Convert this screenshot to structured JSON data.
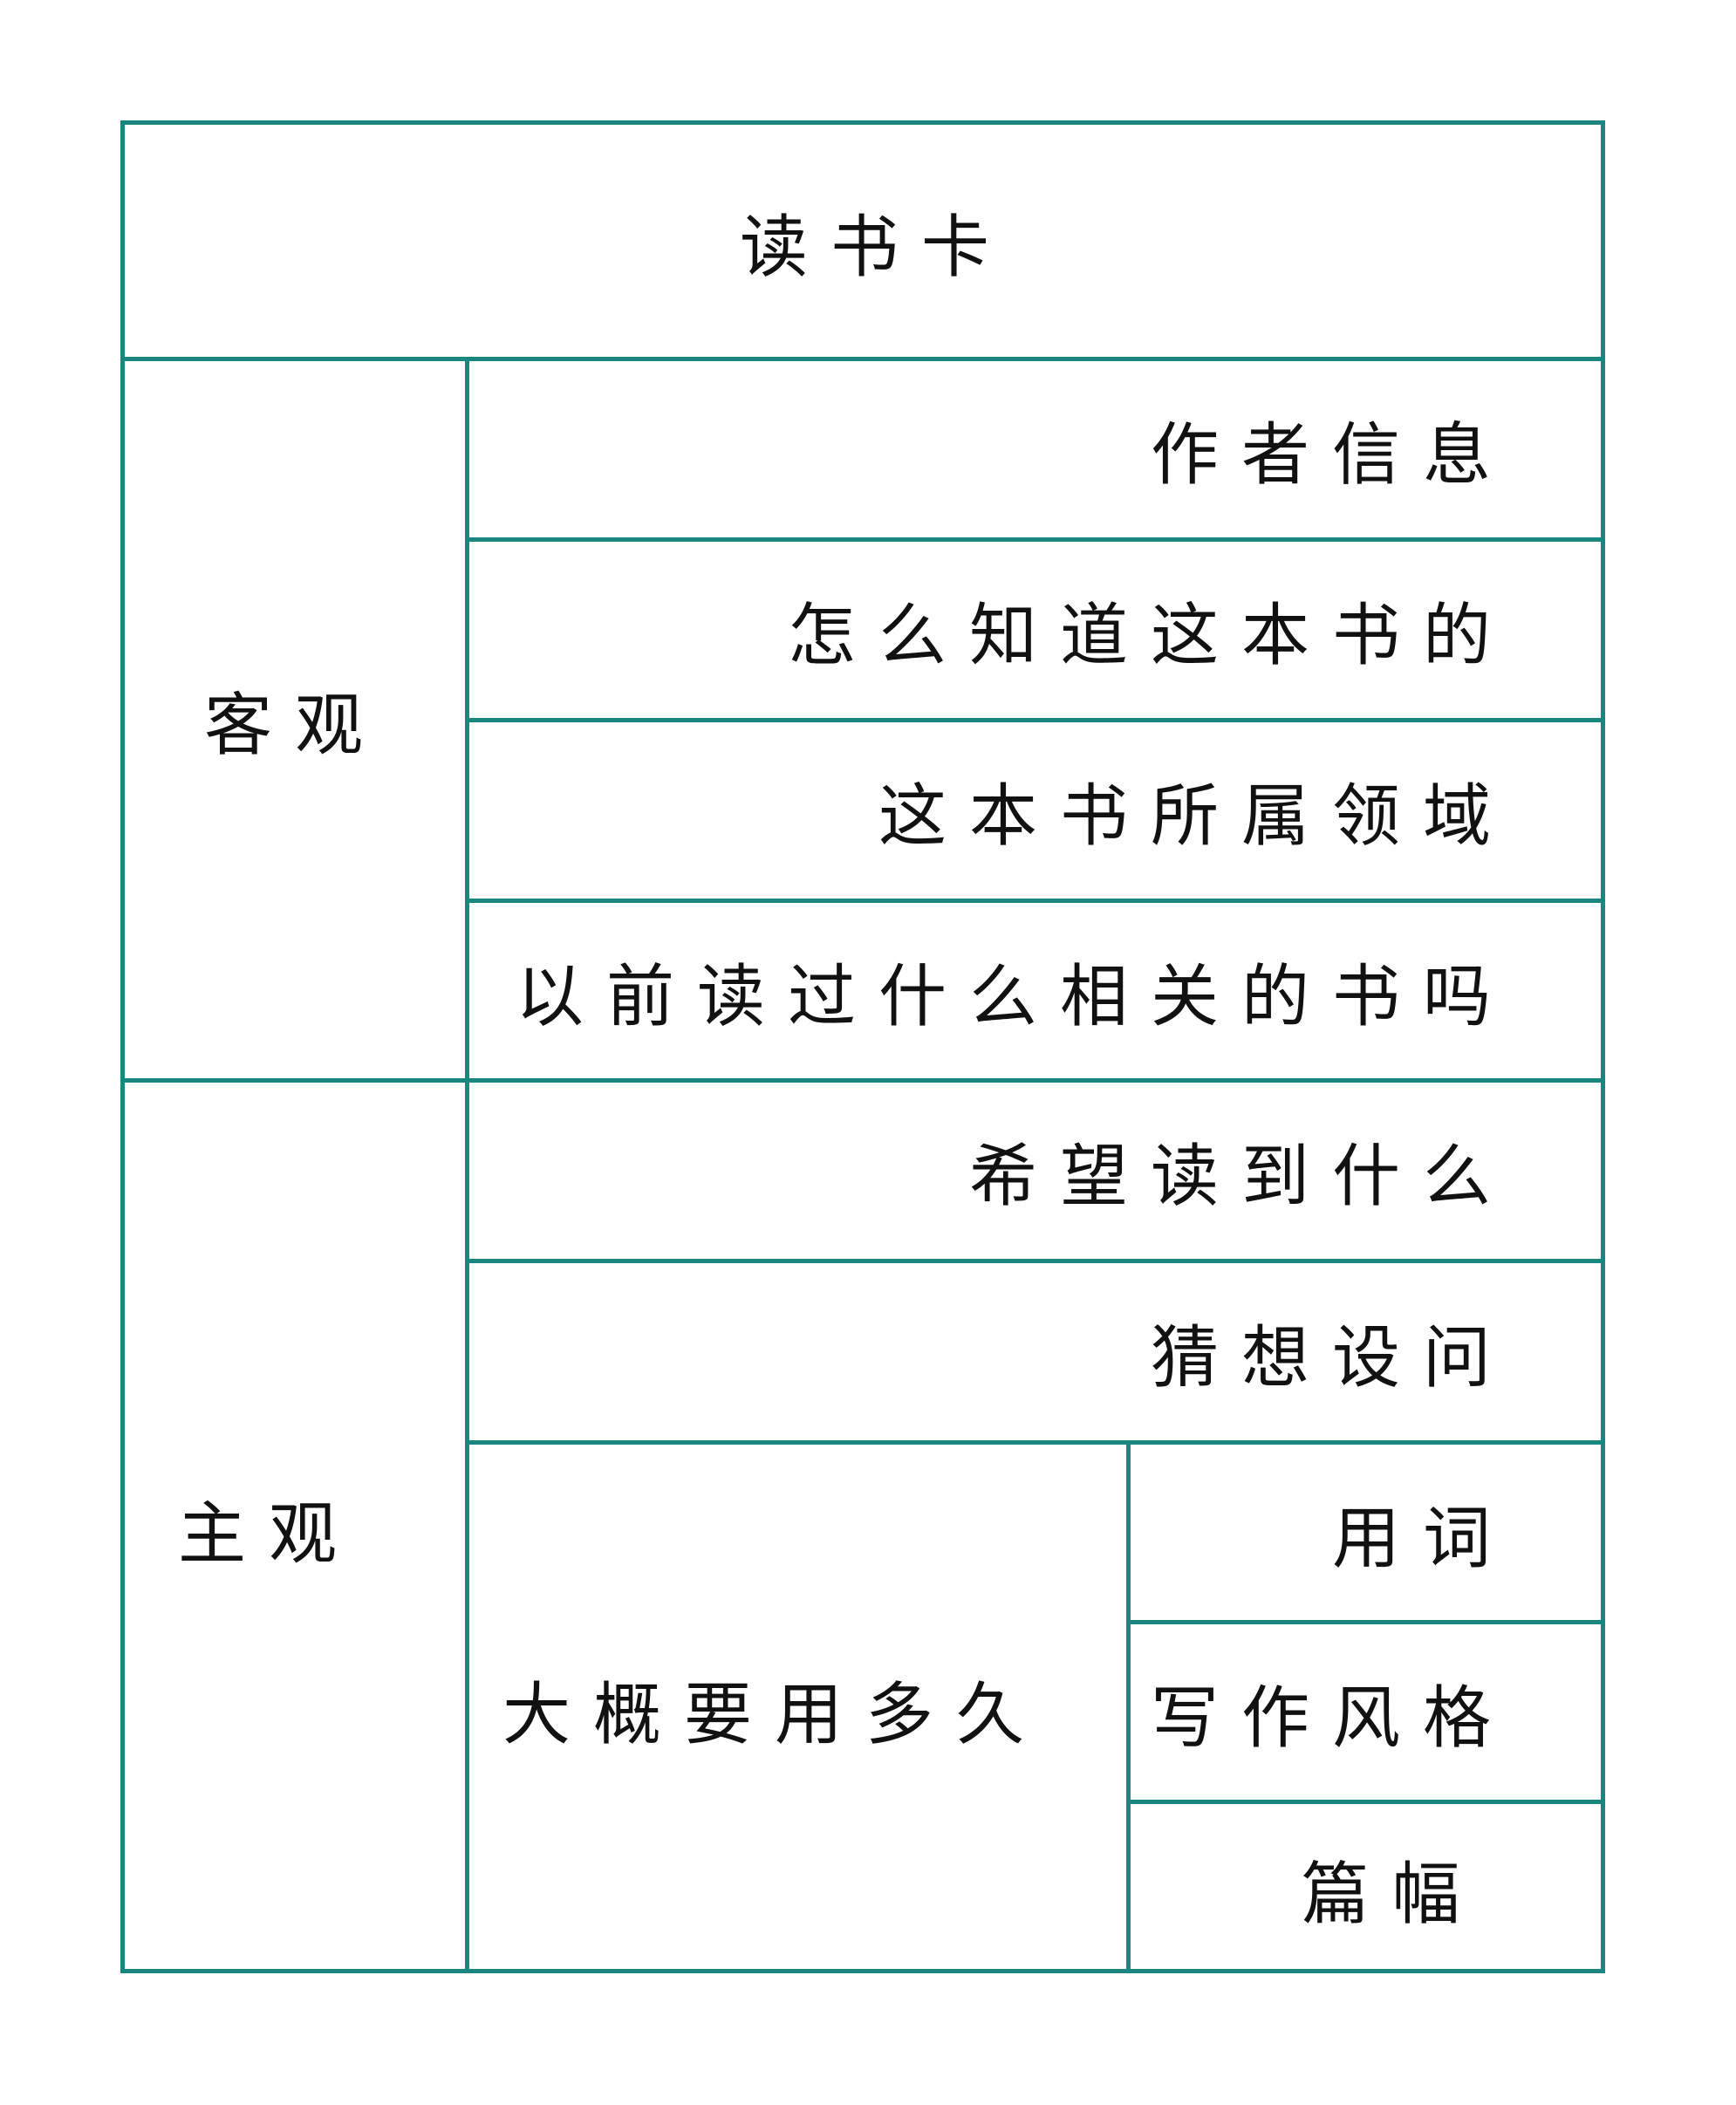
{
  "card": {
    "title": "读书卡",
    "objective": {
      "label": "客观",
      "rows": [
        "作者信息",
        "怎么知道这本书的",
        "这本书所属领域",
        "以前读过什么相关的书吗"
      ]
    },
    "subjective": {
      "label": "主观",
      "rows": [
        "希望读到什么",
        "猜想设问"
      ],
      "duration": "大概要用多久",
      "aspects": [
        "用词",
        "写作风格",
        "篇幅"
      ]
    }
  },
  "colors": {
    "border": "#1a8680",
    "text": "#111111"
  }
}
